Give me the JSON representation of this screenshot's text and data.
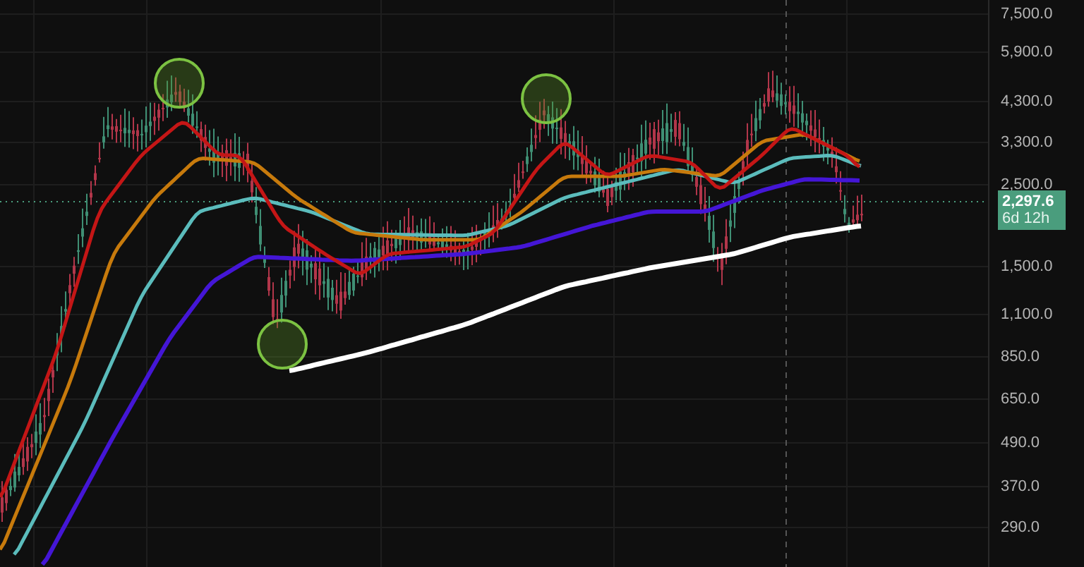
{
  "price_axis": {
    "labels": [
      "7,500.0",
      "5,900.0",
      "4,300.0",
      "3,300.0",
      "2,500.0",
      "1,500.0",
      "1,100.0",
      "850.0",
      "650.0",
      "490.0",
      "370.0",
      "290.0"
    ]
  },
  "last_price": {
    "value": "2,297.6",
    "countdown": "6d 12h"
  }
}
